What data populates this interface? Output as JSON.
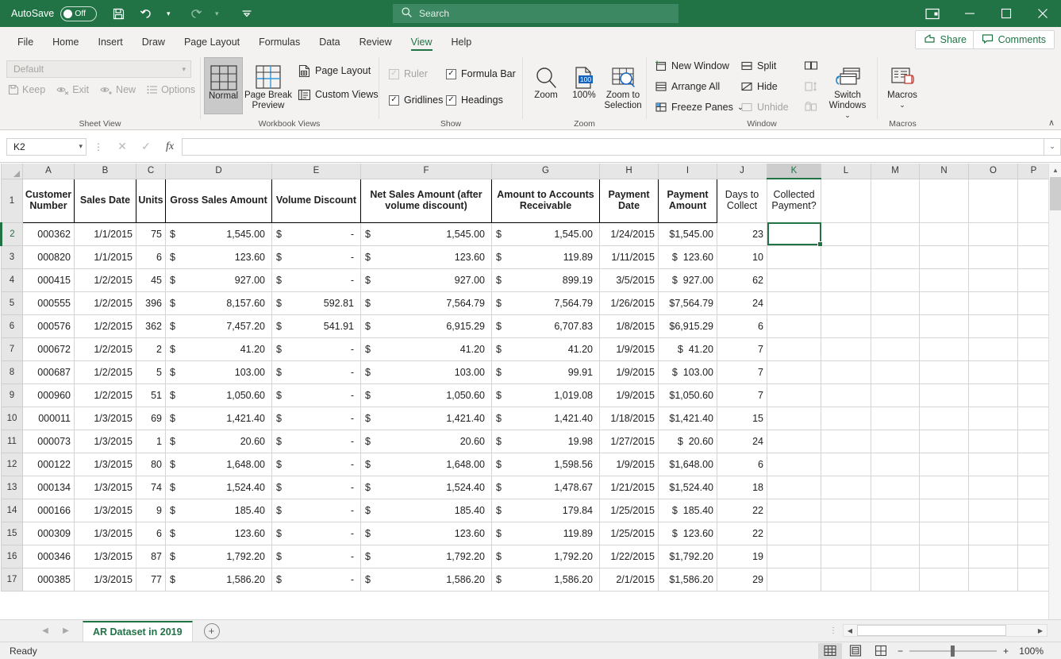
{
  "titlebar": {
    "autosave_label": "AutoSave",
    "autosave_state": "Off",
    "save_icon": "save-icon",
    "undo_icon": "undo-icon",
    "redo_icon": "redo-icon",
    "customize_icon": "customize-quick-access-toolbar-icon",
    "ribbon_display_icon": "ribbon-display-options-icon",
    "minimize_icon": "minimize-icon",
    "maximize_icon": "maximize-icon",
    "close_icon": "close-icon"
  },
  "search": {
    "placeholder": "Search",
    "icon": "search-icon"
  },
  "ribbon_tabs": [
    {
      "label": "File",
      "active": false
    },
    {
      "label": "Home",
      "active": false
    },
    {
      "label": "Insert",
      "active": false
    },
    {
      "label": "Draw",
      "active": false
    },
    {
      "label": "Page Layout",
      "active": false
    },
    {
      "label": "Formulas",
      "active": false
    },
    {
      "label": "Data",
      "active": false
    },
    {
      "label": "Review",
      "active": false
    },
    {
      "label": "View",
      "active": true
    },
    {
      "label": "Help",
      "active": false
    }
  ],
  "share": {
    "label": "Share",
    "icon": "share-icon"
  },
  "comments": {
    "label": "Comments",
    "icon": "comment-icon"
  },
  "ribbon": {
    "collapse_label": "∧",
    "groups": [
      {
        "title": "Sheet View"
      },
      {
        "title": "Workbook Views"
      },
      {
        "title": "Show"
      },
      {
        "title": "Zoom"
      },
      {
        "title": "Window"
      },
      {
        "title": "Macros"
      }
    ],
    "sheet_view": {
      "combo_value": "Default",
      "keep": "Keep",
      "exit": "Exit",
      "new": "New",
      "options": "Options"
    },
    "workbook_views": {
      "normal": "Normal",
      "page_break_preview": "Page Break Preview",
      "page_layout": "Page Layout",
      "custom_views": "Custom Views"
    },
    "show": {
      "ruler": "Ruler",
      "ruler_checked": false,
      "ruler_disabled": true,
      "formula_bar": "Formula Bar",
      "formula_bar_checked": true,
      "gridlines": "Gridlines",
      "gridlines_checked": true,
      "headings": "Headings",
      "headings_checked": true,
      "check_glyph": "✓"
    },
    "zoom": {
      "zoom": "Zoom",
      "hundred": "100%",
      "hundred_badge": "100",
      "zoom_to_selection": "Zoom to Selection"
    },
    "window": {
      "new_window": "New Window",
      "arrange_all": "Arrange All",
      "freeze_panes": "Freeze Panes",
      "split": "Split",
      "hide": "Hide",
      "unhide": "Unhide",
      "switch_windows": "Switch Windows",
      "caret": "⌄"
    },
    "macros": {
      "label": "Macros",
      "caret": "⌄"
    }
  },
  "formula_bar": {
    "name_box": "K2",
    "cancel_icon": "cancel-icon",
    "enter_icon": "enter-icon",
    "function_icon": "insert-function-icon",
    "value": "",
    "expand_icon": "expand-formula-bar-icon"
  },
  "grid": {
    "columns": [
      "A",
      "B",
      "C",
      "D",
      "E",
      "F",
      "G",
      "H",
      "I",
      "J",
      "K",
      "L",
      "M",
      "N",
      "O",
      "P"
    ],
    "selected_column": "K",
    "selected_cell": "K2",
    "rows": [
      "1",
      "2",
      "3",
      "4",
      "5",
      "6",
      "7",
      "8",
      "9",
      "10",
      "11",
      "12",
      "13",
      "14",
      "15",
      "16",
      "17"
    ],
    "selected_row": "2",
    "headers": {
      "A": "Customer Number",
      "B": "Sales Date",
      "C": "Units",
      "D": "Gross Sales Amount",
      "E": "Volume Discount",
      "F": "Net Sales Amount (after volume discount)",
      "G": "Amount to Accounts Receivable",
      "H": "Payment Date",
      "I": "Payment Amount",
      "J": "Days to Collect",
      "K": "Collected Payment?"
    },
    "data": [
      {
        "row": "2",
        "A": "000362",
        "B": "1/1/2015",
        "C": "75",
        "D": "1,545.00",
        "E": "-",
        "F": "1,545.00",
        "G": "1,545.00",
        "H": "1/24/2015",
        "I": "1,545.00",
        "J": "23",
        "K": ""
      },
      {
        "row": "3",
        "A": "000820",
        "B": "1/1/2015",
        "C": "6",
        "D": "123.60",
        "E": "-",
        "F": "123.60",
        "G": "119.89",
        "H": "1/11/2015",
        "I": "123.60",
        "J": "10",
        "K": ""
      },
      {
        "row": "4",
        "A": "000415",
        "B": "1/2/2015",
        "C": "45",
        "D": "927.00",
        "E": "-",
        "F": "927.00",
        "G": "899.19",
        "H": "3/5/2015",
        "I": "927.00",
        "J": "62",
        "K": ""
      },
      {
        "row": "5",
        "A": "000555",
        "B": "1/2/2015",
        "C": "396",
        "D": "8,157.60",
        "E": "592.81",
        "F": "7,564.79",
        "G": "7,564.79",
        "H": "1/26/2015",
        "I": "7,564.79",
        "J": "24",
        "K": ""
      },
      {
        "row": "6",
        "A": "000576",
        "B": "1/2/2015",
        "C": "362",
        "D": "7,457.20",
        "E": "541.91",
        "F": "6,915.29",
        "G": "6,707.83",
        "H": "1/8/2015",
        "I": "6,915.29",
        "J": "6",
        "K": ""
      },
      {
        "row": "7",
        "A": "000672",
        "B": "1/2/2015",
        "C": "2",
        "D": "41.20",
        "E": "-",
        "F": "41.20",
        "G": "41.20",
        "H": "1/9/2015",
        "I": "41.20",
        "J": "7",
        "K": ""
      },
      {
        "row": "8",
        "A": "000687",
        "B": "1/2/2015",
        "C": "5",
        "D": "103.00",
        "E": "-",
        "F": "103.00",
        "G": "99.91",
        "H": "1/9/2015",
        "I": "103.00",
        "J": "7",
        "K": ""
      },
      {
        "row": "9",
        "A": "000960",
        "B": "1/2/2015",
        "C": "51",
        "D": "1,050.60",
        "E": "-",
        "F": "1,050.60",
        "G": "1,019.08",
        "H": "1/9/2015",
        "I": "1,050.60",
        "J": "7",
        "K": ""
      },
      {
        "row": "10",
        "A": "000011",
        "B": "1/3/2015",
        "C": "69",
        "D": "1,421.40",
        "E": "-",
        "F": "1,421.40",
        "G": "1,421.40",
        "H": "1/18/2015",
        "I": "1,421.40",
        "J": "15",
        "K": ""
      },
      {
        "row": "11",
        "A": "000073",
        "B": "1/3/2015",
        "C": "1",
        "D": "20.60",
        "E": "-",
        "F": "20.60",
        "G": "19.98",
        "H": "1/27/2015",
        "I": "20.60",
        "J": "24",
        "K": ""
      },
      {
        "row": "12",
        "A": "000122",
        "B": "1/3/2015",
        "C": "80",
        "D": "1,648.00",
        "E": "-",
        "F": "1,648.00",
        "G": "1,598.56",
        "H": "1/9/2015",
        "I": "1,648.00",
        "J": "6",
        "K": ""
      },
      {
        "row": "13",
        "A": "000134",
        "B": "1/3/2015",
        "C": "74",
        "D": "1,524.40",
        "E": "-",
        "F": "1,524.40",
        "G": "1,478.67",
        "H": "1/21/2015",
        "I": "1,524.40",
        "J": "18",
        "K": ""
      },
      {
        "row": "14",
        "A": "000166",
        "B": "1/3/2015",
        "C": "9",
        "D": "185.40",
        "E": "-",
        "F": "185.40",
        "G": "179.84",
        "H": "1/25/2015",
        "I": "185.40",
        "J": "22",
        "K": ""
      },
      {
        "row": "15",
        "A": "000309",
        "B": "1/3/2015",
        "C": "6",
        "D": "123.60",
        "E": "-",
        "F": "123.60",
        "G": "119.89",
        "H": "1/25/2015",
        "I": "123.60",
        "J": "22",
        "K": ""
      },
      {
        "row": "16",
        "A": "000346",
        "B": "1/3/2015",
        "C": "87",
        "D": "1,792.20",
        "E": "-",
        "F": "1,792.20",
        "G": "1,792.20",
        "H": "1/22/2015",
        "I": "1,792.20",
        "J": "19",
        "K": ""
      },
      {
        "row": "17",
        "A": "000385",
        "B": "1/3/2015",
        "C": "77",
        "D": "1,586.20",
        "E": "-",
        "F": "1,586.20",
        "G": "1,586.20",
        "H": "2/1/2015",
        "I": "1,586.20",
        "J": "29",
        "K": ""
      }
    ],
    "currency_symbol": "$"
  },
  "sheet_tabs": {
    "first_icon": "first-sheet-icon",
    "prev_icon": "previous-sheet-icon",
    "tabs": [
      {
        "label": "AR Dataset in 2019",
        "active": true
      }
    ],
    "add_label": "+"
  },
  "statusbar": {
    "status": "Ready",
    "normal_view_icon": "normal-view-icon",
    "page_layout_icon": "page-layout-view-icon",
    "page_break_icon": "page-break-preview-icon",
    "zoom_out": "−",
    "zoom_in": "+",
    "zoom_level": "100%"
  },
  "colors": {
    "excel_green": "#217346",
    "ribbon_bg": "#f3f2f1",
    "grid_line": "#d4d4d4"
  }
}
